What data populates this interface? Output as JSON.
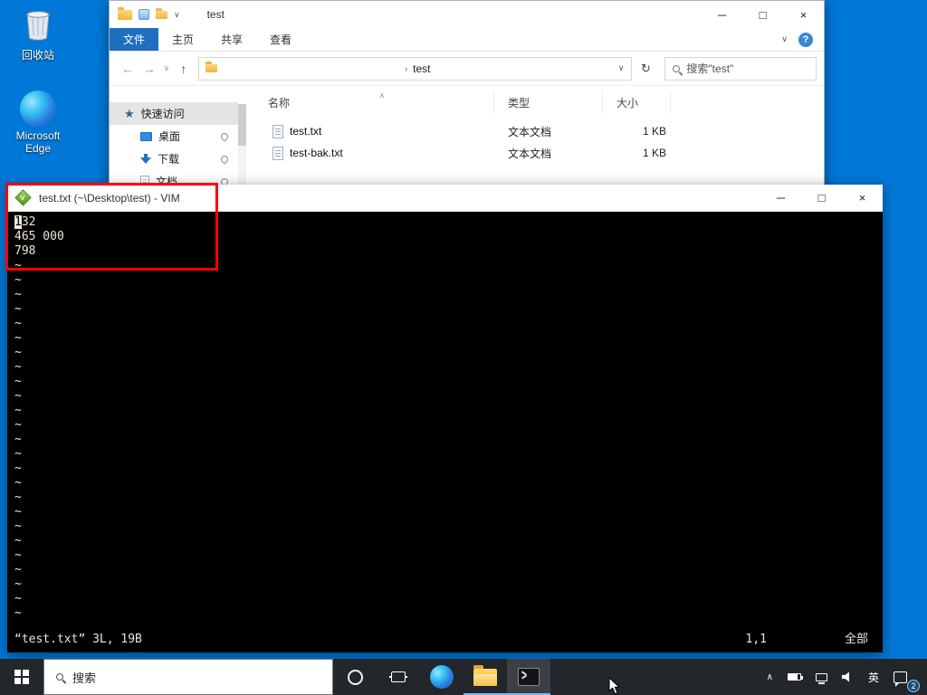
{
  "colors": {
    "desktop_bg": "#0078d7",
    "accent": "#1f6fc0",
    "annotation": "#ff0000"
  },
  "icons": {
    "minimize": "─",
    "maximize": "□",
    "close": "×",
    "back": "←",
    "forward": "→",
    "up": "↑",
    "refresh": "↻",
    "caret_down": "∨",
    "caret_up": "∧",
    "sort_asc": "∧",
    "help": "?",
    "star": "★",
    "tray_expand": "∧"
  },
  "desktop": {
    "icons": [
      {
        "label": "回收站"
      },
      {
        "label": "Microsoft Edge"
      }
    ]
  },
  "explorer": {
    "title": "test",
    "tabs": [
      {
        "label": "文件",
        "active": true
      },
      {
        "label": "主页",
        "active": false
      },
      {
        "label": "共享",
        "active": false
      },
      {
        "label": "查看",
        "active": false
      }
    ],
    "breadcrumb": "test",
    "search_text": "搜索\"test\"",
    "sidebar": {
      "quick_access": "快速访问",
      "items": [
        {
          "label": "桌面",
          "pinned": true
        },
        {
          "label": "下载",
          "pinned": true
        },
        {
          "label": "文档",
          "pinned": true
        }
      ]
    },
    "list": {
      "columns": [
        "名称",
        "类型",
        "大小"
      ],
      "files": [
        {
          "name": "test.txt",
          "type": "文本文档",
          "size": "1 KB"
        },
        {
          "name": "test-bak.txt",
          "type": "文本文档",
          "size": "1 KB"
        }
      ]
    }
  },
  "vim": {
    "title": "test.txt (~\\Desktop\\test) - VIM",
    "buffer_lines": [
      "132",
      "465 000",
      "798"
    ],
    "tilde_char": "~",
    "tilde_count": 25,
    "status_left": "“test.txt” 3L, 19B",
    "ruler": "1,1",
    "scroll_indicator": "全部"
  },
  "taskbar": {
    "search_text": "搜索",
    "language": "英",
    "notification_badge": "2"
  }
}
